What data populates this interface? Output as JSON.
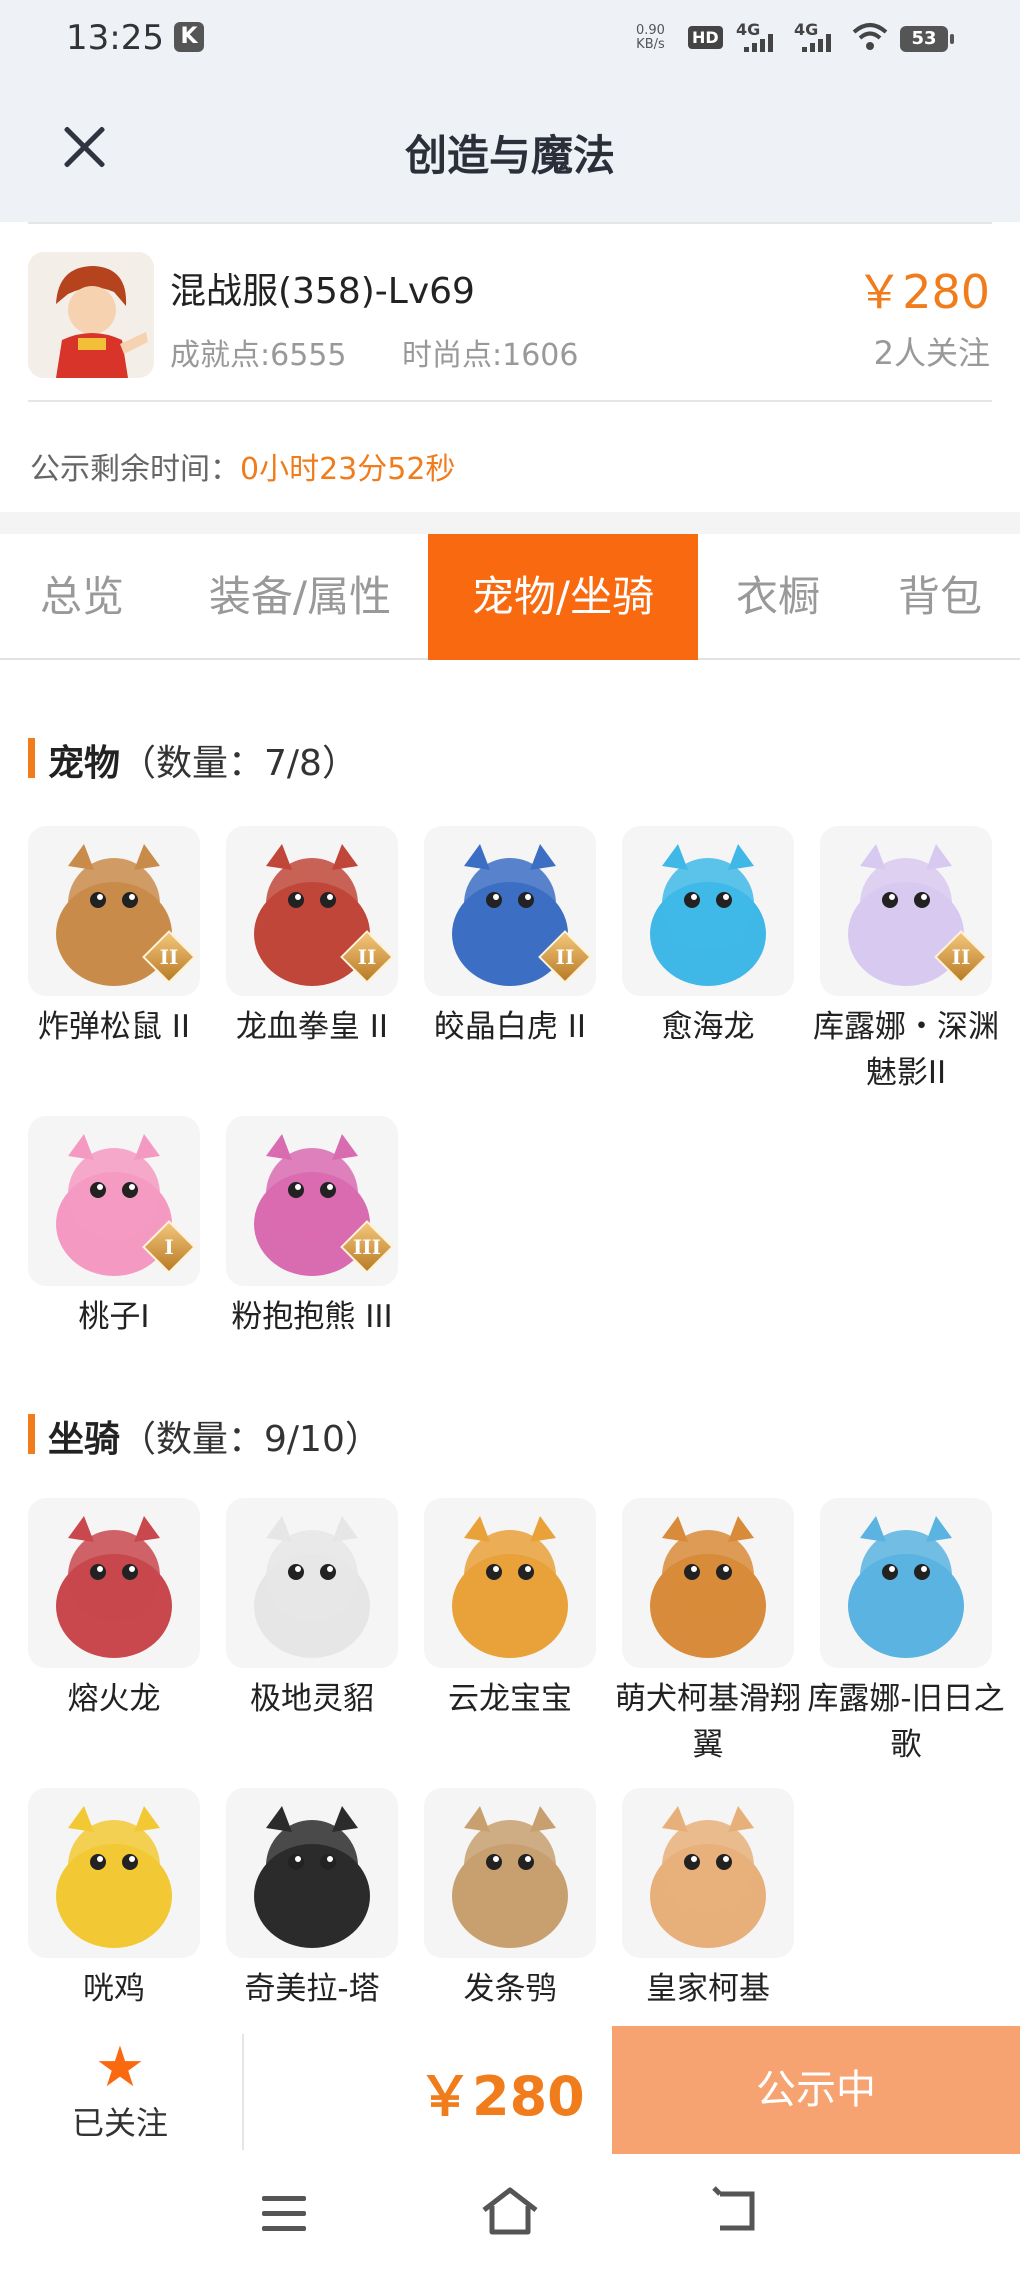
{
  "status": {
    "time": "13:25",
    "app_badge": "K",
    "net_speed_value": "0.90",
    "net_speed_unit": "KB/s",
    "hd": "HD",
    "sim1": "4G",
    "sim2": "4G",
    "battery": "53"
  },
  "header": {
    "title": "创造与魔法"
  },
  "product": {
    "server": "混战服(358)-Lv69",
    "achievement": "成就点:6555",
    "fashion": "时尚点:1606",
    "price": "￥280",
    "followers": "2人关注",
    "notice_label": "公示剩余时间：",
    "notice_time": "0小时23分52秒"
  },
  "tabs": [
    {
      "label": "总览"
    },
    {
      "label": "装备/属性"
    },
    {
      "label": "宠物/坐骑"
    },
    {
      "label": "衣橱"
    },
    {
      "label": "背包"
    }
  ],
  "pets": {
    "title": "宠物",
    "count": "（数量：7/8）",
    "items": [
      {
        "name": "炸弹松鼠 II",
        "badge": "II",
        "color": "#c98b4a"
      },
      {
        "name": "龙血拳皇 II",
        "badge": "II",
        "color": "#c0463a"
      },
      {
        "name": "皎晶白虎 II",
        "badge": "II",
        "color": "#3c6fc4"
      },
      {
        "name": "愈海龙",
        "badge": "",
        "color": "#3fb8e8"
      },
      {
        "name": "库露娜・深渊魅影II",
        "badge": "II",
        "color": "#d8c9f0"
      },
      {
        "name": "桃子I",
        "badge": "I",
        "color": "#f49ac2"
      },
      {
        "name": "粉抱抱熊 III",
        "badge": "III",
        "color": "#d96bb0"
      }
    ]
  },
  "mounts": {
    "title": "坐骑",
    "count": "（数量：9/10）",
    "items": [
      {
        "name": "熔火龙",
        "color": "#c8484e"
      },
      {
        "name": "极地灵貂",
        "color": "#e6e6e6"
      },
      {
        "name": "云龙宝宝",
        "color": "#e9a13a"
      },
      {
        "name": "萌犬柯基滑翔翼",
        "color": "#d88b3a"
      },
      {
        "name": "库露娜-旧日之歌",
        "color": "#5ab3e0"
      },
      {
        "name": "咣鸡",
        "color": "#f2c935"
      },
      {
        "name": "奇美拉-塔",
        "color": "#2b2b2b"
      },
      {
        "name": "发条鸮",
        "color": "#c8a070"
      },
      {
        "name": "皇家柯基",
        "color": "#e7b07a"
      }
    ]
  },
  "footer": {
    "follow_label": "已关注",
    "price": "￥280",
    "action": "公示中"
  }
}
